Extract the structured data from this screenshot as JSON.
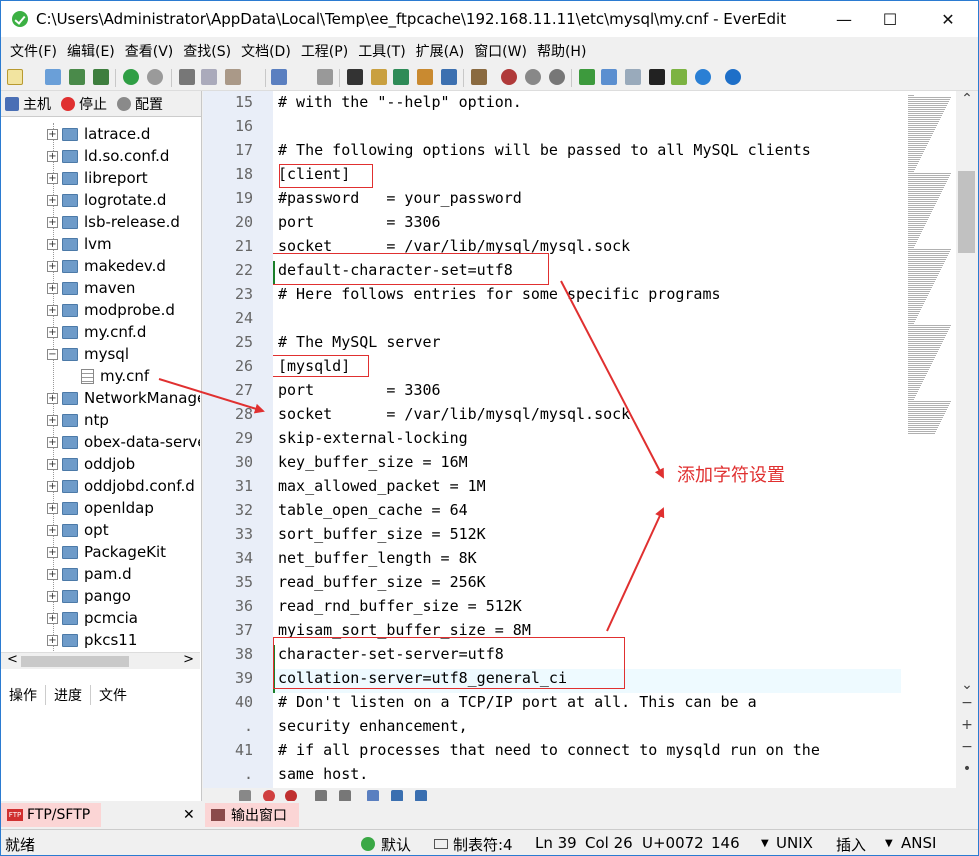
{
  "window": {
    "title": "C:\\Users\\Administrator\\AppData\\Local\\Temp\\ee_ftpcache\\192.168.11.11\\etc\\mysql\\my.cnf - EverEdit",
    "controls": {
      "minimize": "—",
      "maximize": "☐",
      "close": "✕"
    }
  },
  "menu": [
    "文件(F)",
    "编辑(E)",
    "查看(V)",
    "查找(S)",
    "文档(D)",
    "工程(P)",
    "工具(T)",
    "扩展(A)",
    "窗口(W)",
    "帮助(H)"
  ],
  "left_panel": {
    "tabs": [
      "主机",
      "停止",
      "配置"
    ],
    "tree": [
      {
        "label": "latrace.d",
        "kind": "folder"
      },
      {
        "label": "ld.so.conf.d",
        "kind": "folder"
      },
      {
        "label": "libreport",
        "kind": "folder"
      },
      {
        "label": "logrotate.d",
        "kind": "folder"
      },
      {
        "label": "lsb-release.d",
        "kind": "folder"
      },
      {
        "label": "lvm",
        "kind": "folder"
      },
      {
        "label": "makedev.d",
        "kind": "folder"
      },
      {
        "label": "maven",
        "kind": "folder"
      },
      {
        "label": "modprobe.d",
        "kind": "folder"
      },
      {
        "label": "my.cnf.d",
        "kind": "folder"
      },
      {
        "label": "mysql",
        "kind": "folder-open"
      },
      {
        "label": "my.cnf",
        "kind": "file"
      },
      {
        "label": "NetworkManager",
        "kind": "folder"
      },
      {
        "label": "ntp",
        "kind": "folder"
      },
      {
        "label": "obex-data-server",
        "kind": "folder"
      },
      {
        "label": "oddjob",
        "kind": "folder"
      },
      {
        "label": "oddjobd.conf.d",
        "kind": "folder"
      },
      {
        "label": "openldap",
        "kind": "folder"
      },
      {
        "label": "opt",
        "kind": "folder"
      },
      {
        "label": "PackageKit",
        "kind": "folder"
      },
      {
        "label": "pam.d",
        "kind": "folder"
      },
      {
        "label": "pango",
        "kind": "folder"
      },
      {
        "label": "pcmcia",
        "kind": "folder"
      },
      {
        "label": "pkcs11",
        "kind": "folder"
      }
    ],
    "bottom_tabs": [
      "操作",
      "进度",
      "文件"
    ]
  },
  "editor": {
    "lines": [
      {
        "n": "15",
        "text": "# with the \"--help\" option."
      },
      {
        "n": "16",
        "text": ""
      },
      {
        "n": "17",
        "text": "# The following options will be passed to all MySQL clients"
      },
      {
        "n": "18",
        "text": "[client]"
      },
      {
        "n": "19",
        "text": "#password   = your_password"
      },
      {
        "n": "20",
        "text": "port        = 3306"
      },
      {
        "n": "21",
        "text": "socket      = /var/lib/mysql/mysql.sock"
      },
      {
        "n": "22",
        "text": "default-character-set=utf8"
      },
      {
        "n": "23",
        "text": "# Here follows entries for some specific programs"
      },
      {
        "n": "24",
        "text": ""
      },
      {
        "n": "25",
        "text": "# The MySQL server"
      },
      {
        "n": "26",
        "text": "[mysqld]"
      },
      {
        "n": "27",
        "text": "port        = 3306"
      },
      {
        "n": "28",
        "text": "socket      = /var/lib/mysql/mysql.sock"
      },
      {
        "n": "29",
        "text": "skip-external-locking"
      },
      {
        "n": "30",
        "text": "key_buffer_size = 16M"
      },
      {
        "n": "31",
        "text": "max_allowed_packet = 1M"
      },
      {
        "n": "32",
        "text": "table_open_cache = 64"
      },
      {
        "n": "33",
        "text": "sort_buffer_size = 512K"
      },
      {
        "n": "34",
        "text": "net_buffer_length = 8K"
      },
      {
        "n": "35",
        "text": "read_buffer_size = 256K"
      },
      {
        "n": "36",
        "text": "read_rnd_buffer_size = 512K"
      },
      {
        "n": "37",
        "text": "myisam_sort_buffer_size = 8M"
      },
      {
        "n": "38",
        "text": "character-set-server=utf8"
      },
      {
        "n": "39",
        "text": "collation-server=utf8_general_ci"
      },
      {
        "n": "40",
        "text": "# Don't listen on a TCP/IP port at all. This can be a"
      },
      {
        "n": ".",
        "text": "security enhancement,"
      },
      {
        "n": "41",
        "text": "# if all processes that need to connect to mysqld run on the"
      },
      {
        "n": ".",
        "text": "same host."
      }
    ]
  },
  "annotation": {
    "label": "添加字符设置"
  },
  "panel_tabs": {
    "ftp": "FTP/SFTP",
    "output": "输出窗口"
  },
  "status": {
    "ready": "就绪",
    "encoding_mode": "默认",
    "tab": "制表符:4",
    "line": "Ln 39",
    "col": "Col 26",
    "char": "U+0072",
    "offset": "146",
    "eol": "UNIX",
    "insert": "插入",
    "charset": "ANSI"
  }
}
